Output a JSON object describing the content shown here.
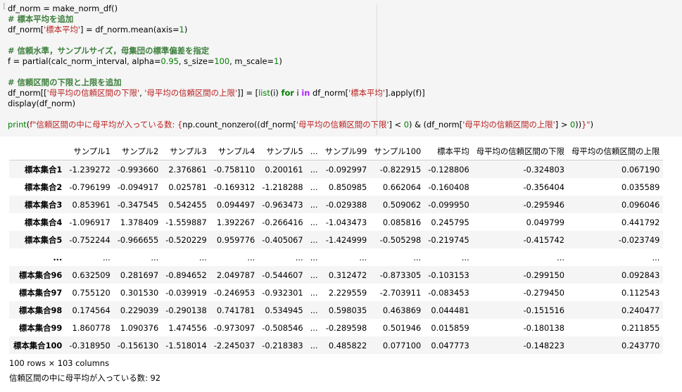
{
  "code": {
    "gutter": "[",
    "line1": "df_norm = make_norm_df()",
    "line2_comment": "# 標本平均を追加",
    "line3_pre": "df_norm[",
    "line3_str": "'標本平均'",
    "line3_mid": "] = df_norm.mean(axis=",
    "line3_num": "1",
    "line3_post": ")",
    "line4_comment": "# 信頼水準，サンプルサイズ，母集団の標準偏差を指定",
    "line5_pre": "f = partial(calc_norm_interval, alpha=",
    "line5_n1": "0.95",
    "line5_m1": ", s_size=",
    "line5_n2": "100",
    "line5_m2": ", m_scale=",
    "line5_n3": "1",
    "line5_post": ")",
    "line6_comment": "# 信頼区間の下限と上限を追加",
    "line7_a": "df_norm[[",
    "line7_s1": "'母平均の信頼区間の下限'",
    "line7_b": ", ",
    "line7_s2": "'母平均の信頼区間の上限'",
    "line7_c": "]] = [",
    "line7_list": "list",
    "line7_d": "(i) ",
    "line7_for": "for",
    "line7_e": " i ",
    "line7_in": "in",
    "line7_f": " df_norm[",
    "line7_s3": "'標本平均'",
    "line7_g": "].apply(f)]",
    "line8": "display(df_norm)",
    "line9_print": "print",
    "line9_a": "(",
    "line9_s1": "f\"信頼区間の中に母平均が入っている数: {",
    "line9_b": "np.count_nonzero((df_norm[",
    "line9_s2": "'母平均の信頼区間の下限'",
    "line9_c": "] < ",
    "line9_n1": "0",
    "line9_d": ") & (df_norm[",
    "line9_s3": "'母平均の信頼区間の上限'",
    "line9_e": "] > ",
    "line9_n2": "0",
    "line9_f": "))",
    "line9_s4": "}\"",
    "line9_g": ")"
  },
  "table": {
    "columns": [
      "",
      "サンプル1",
      "サンプル2",
      "サンプル3",
      "サンプル4",
      "サンプル5",
      "...",
      "サンプル99",
      "サンプル100",
      "標本平均",
      "母平均の信頼区間の下限",
      "母平均の信頼区間の上限"
    ],
    "rows": [
      [
        "標本集合1",
        "-1.239272",
        "-0.993660",
        "2.376861",
        "-0.758110",
        "0.200161",
        "...",
        "-0.092997",
        "-0.822915",
        "-0.128806",
        "-0.324803",
        "0.067190"
      ],
      [
        "標本集合2",
        "-0.796199",
        "-0.094917",
        "0.025781",
        "-0.169312",
        "-1.218288",
        "...",
        "0.850985",
        "0.662064",
        "-0.160408",
        "-0.356404",
        "0.035589"
      ],
      [
        "標本集合3",
        "0.853961",
        "-0.347545",
        "0.542455",
        "0.094497",
        "-0.963473",
        "...",
        "-0.029388",
        "0.509062",
        "-0.099950",
        "-0.295946",
        "0.096046"
      ],
      [
        "標本集合4",
        "-1.096917",
        "1.378409",
        "-1.559887",
        "1.392267",
        "-0.266416",
        "...",
        "-1.043473",
        "0.085816",
        "0.245795",
        "0.049799",
        "0.441792"
      ],
      [
        "標本集合5",
        "-0.752244",
        "-0.966655",
        "-0.520229",
        "0.959776",
        "-0.405067",
        "...",
        "-1.424999",
        "-0.505298",
        "-0.219745",
        "-0.415742",
        "-0.023749"
      ],
      [
        "...",
        "...",
        "...",
        "...",
        "...",
        "...",
        "...",
        "...",
        "...",
        "...",
        "...",
        "..."
      ],
      [
        "標本集合96",
        "0.632509",
        "0.281697",
        "-0.894652",
        "2.049787",
        "-0.544607",
        "...",
        "0.312472",
        "-0.873305",
        "-0.103153",
        "-0.299150",
        "0.092843"
      ],
      [
        "標本集合97",
        "0.755120",
        "0.301530",
        "-0.039919",
        "-0.246953",
        "-0.932301",
        "...",
        "2.229559",
        "-2.703911",
        "-0.083453",
        "-0.279450",
        "0.112543"
      ],
      [
        "標本集合98",
        "0.174564",
        "0.229039",
        "-0.290138",
        "0.741781",
        "0.534945",
        "...",
        "0.598035",
        "0.463869",
        "0.044481",
        "-0.151516",
        "0.240477"
      ],
      [
        "標本集合99",
        "1.860778",
        "1.090376",
        "1.474556",
        "-0.973097",
        "-0.508546",
        "...",
        "-0.289598",
        "0.501946",
        "0.015859",
        "-0.180138",
        "0.211855"
      ],
      [
        "標本集合100",
        "-0.318950",
        "-0.156130",
        "-1.518014",
        "-2.245037",
        "-0.218383",
        "...",
        "0.485822",
        "0.077100",
        "0.047773",
        "-0.148223",
        "0.243770"
      ]
    ]
  },
  "footer": {
    "shape": "100 rows × 103 columns",
    "result": "信頼区間の中に母平均が入っている数: 92"
  }
}
